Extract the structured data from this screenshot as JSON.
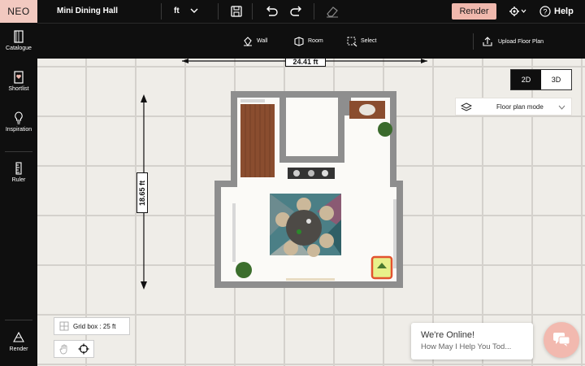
{
  "app": {
    "logo": "NEO",
    "project_name": "Mini Dining Hall",
    "unit": "ft"
  },
  "topbar": {
    "render_label": "Render",
    "help_label": "Help"
  },
  "tools": {
    "wall": "Wall",
    "room": "Room",
    "select": "Select",
    "upload": "Upload Floor Plan"
  },
  "sidebar": {
    "items": [
      {
        "label": "Catalogue",
        "icon": "catalogue-icon"
      },
      {
        "label": "Shortlist",
        "icon": "shortlist-icon"
      },
      {
        "label": "Inspiration",
        "icon": "bulb-icon"
      },
      {
        "label": "Ruler",
        "icon": "ruler-icon"
      },
      {
        "label": "Render",
        "icon": "render-icon"
      }
    ]
  },
  "canvas": {
    "width_label": "24.41 ft",
    "height_label": "18.65 ft",
    "view_2d": "2D",
    "view_3d": "3D",
    "active_view": "2D",
    "plan_mode": "Floor plan mode",
    "grid_box_label": "Grid box : 25 ft"
  },
  "chat": {
    "line1": "We're Online!",
    "line2": "How May I Help You Tod..."
  },
  "colors": {
    "accent": "#f0b8ad",
    "bar": "#0f0f0f",
    "canvas": "#efede8",
    "highlight": "#e2532f"
  }
}
